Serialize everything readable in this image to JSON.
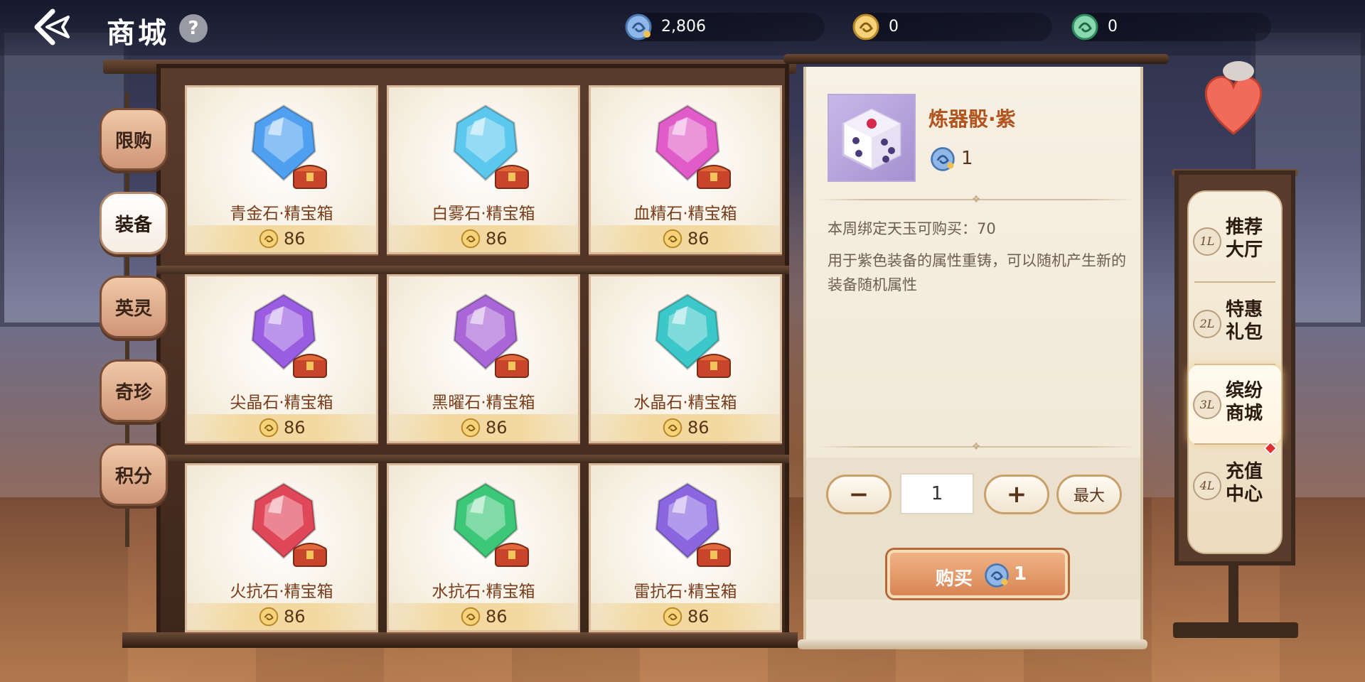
{
  "header": {
    "title": "商城",
    "help": "?",
    "currencies": [
      {
        "icon": "blue-jade-coin-icon",
        "value": "2,806"
      },
      {
        "icon": "gold-coin-icon",
        "value": "0"
      },
      {
        "icon": "green-coin-icon",
        "value": "0"
      }
    ]
  },
  "left_tabs": [
    {
      "label": "限购",
      "active": false
    },
    {
      "label": "装备",
      "active": true
    },
    {
      "label": "英灵",
      "active": false
    },
    {
      "label": "奇珍",
      "active": false
    },
    {
      "label": "积分",
      "active": false
    }
  ],
  "items": [
    {
      "name": "青金石·精宝箱",
      "price": "86",
      "gem_color": "#4fa0f0"
    },
    {
      "name": "白雾石·精宝箱",
      "price": "86",
      "gem_color": "#5cc8ee"
    },
    {
      "name": "血精石·精宝箱",
      "price": "86",
      "gem_color": "#e05cc8"
    },
    {
      "name": "尖晶石·精宝箱",
      "price": "86",
      "gem_color": "#9a5ce0"
    },
    {
      "name": "黑曜石·精宝箱",
      "price": "86",
      "gem_color": "#a866d6"
    },
    {
      "name": "水晶石·精宝箱",
      "price": "86",
      "gem_color": "#3cc8c8"
    },
    {
      "name": "火抗石·精宝箱",
      "price": "86",
      "gem_color": "#e0485a"
    },
    {
      "name": "水抗石·精宝箱",
      "price": "86",
      "gem_color": "#3cc878"
    },
    {
      "name": "雷抗石·精宝箱",
      "price": "86",
      "gem_color": "#8a66e0"
    }
  ],
  "detail": {
    "name": "炼器骰·紫",
    "cost": "1",
    "limit": "本周绑定天玉可购买：70",
    "description": "用于紫色装备的属性重铸，可以随机产生新的装备随机属性",
    "quantity": "1",
    "minus": "−",
    "plus": "+",
    "max_label": "最大",
    "buy_label": "购买",
    "buy_cost": "1"
  },
  "right_nav": [
    {
      "floor": "1L",
      "label": "推荐大厅",
      "active": false
    },
    {
      "floor": "2L",
      "label": "特惠礼包",
      "active": false
    },
    {
      "floor": "3L",
      "label": "缤纷商城",
      "active": true
    },
    {
      "floor": "4L",
      "label": "充值中心",
      "active": false,
      "badge": true
    }
  ],
  "colors": {
    "accent": "#b2541e",
    "buy_button": "#d98555",
    "badge": "#e02f2f"
  }
}
